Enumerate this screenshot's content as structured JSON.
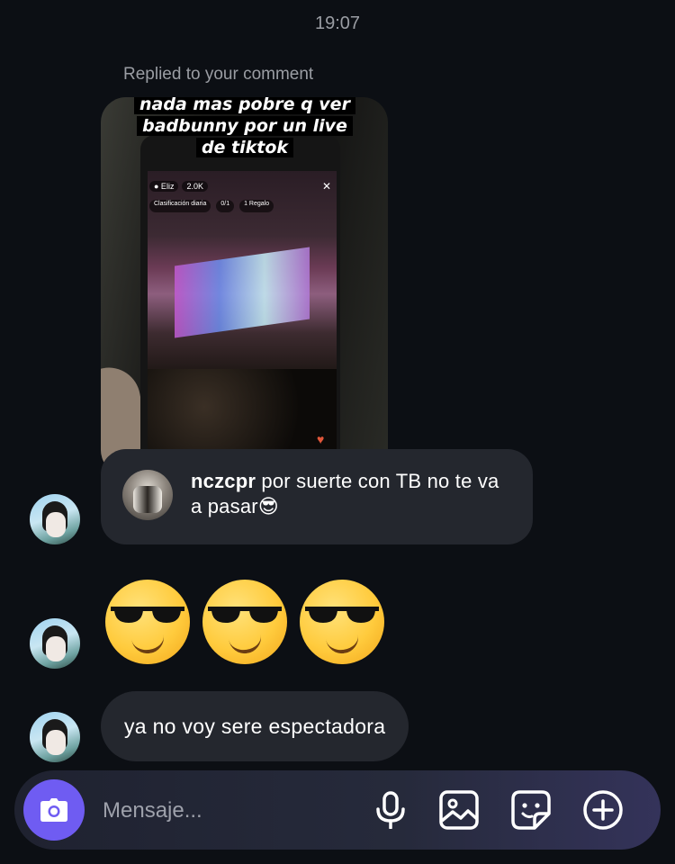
{
  "thread": {
    "timestamp": "19:07",
    "replied_label": "Replied to your comment"
  },
  "story": {
    "caption": [
      "nada mas pobre q ver",
      "badbunny por un live",
      "de tiktok"
    ],
    "embedded_topbar": {
      "viewers": "2.0K",
      "ranking": "Clasificación diaria",
      "progress": "0/1",
      "gift": "1 Regalo"
    }
  },
  "reply": {
    "username": "nczcpr",
    "text": "por suerte con TB no te va a pasar",
    "emoji": "😎"
  },
  "emoji_message": {
    "emoji_count": 3,
    "emoji": "smiling-face-with-sunglasses"
  },
  "text_message": {
    "text": "ya no voy sere espectadora"
  },
  "composer": {
    "placeholder": "Mensaje...",
    "accent": "#6f5cf2"
  },
  "colors": {
    "background": "#0c0f14",
    "bubble": "#24272e",
    "muted_text": "#9a9da3"
  }
}
